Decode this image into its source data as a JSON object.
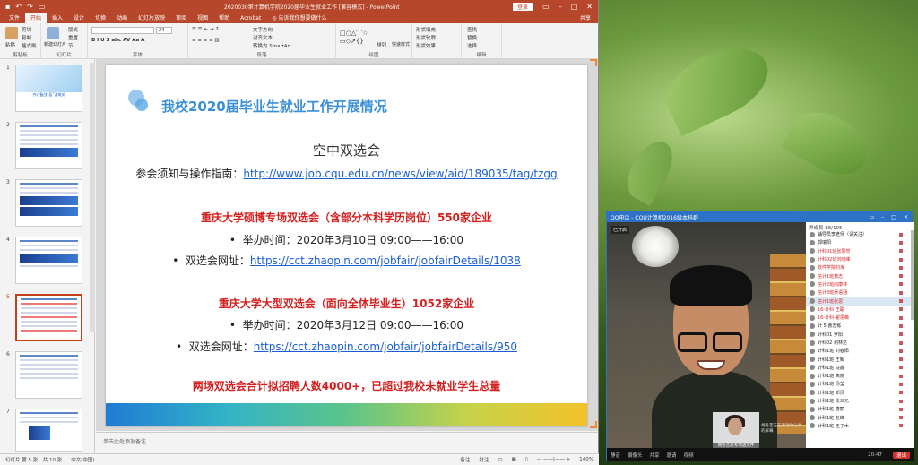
{
  "ppt": {
    "title": "2020030第计算机学院2020届毕业生就业工作 [兼容模式] - PowerPoint",
    "login": "登录",
    "tabs": [
      "文件",
      "开始",
      "插入",
      "设计",
      "切换",
      "动画",
      "幻灯片放映",
      "审阅",
      "视图",
      "帮助",
      "Acrobat"
    ],
    "active_tab": "开始",
    "tell_me": "告诉我你想要做什么",
    "share": "共享",
    "ribbon": {
      "paste": "粘贴",
      "cut": "剪切",
      "copy": "复制",
      "format_painter": "格式刷",
      "new_slide": "新建幻灯片",
      "layout": "版式",
      "reset": "重置",
      "section": "节",
      "font_size": "24",
      "text_direction": "文字方向",
      "align_text": "对齐文本",
      "convert_smartart": "转换为 SmartArt",
      "arrange": "排列",
      "quick_styles": "快速样式",
      "shape_fill": "形状填充",
      "shape_outline": "形状轮廓",
      "shape_effects": "形状效果",
      "find": "查找",
      "replace": "替换",
      "select": "选择",
      "groups": [
        "剪贴板",
        "幻灯片",
        "字体",
        "段落",
        "绘图",
        "编辑"
      ]
    },
    "slide": {
      "heading": "我校2020届毕业生就业工作开展情况",
      "subtitle": "空中双选会",
      "guide_label": "参会须知与操作指南：",
      "guide_link": "http://www.job.cqu.edu.cn/news/view/aid/189035/tag/tzgg",
      "fair1_title": "重庆大学硕博专场双选会（含部分本科学历岗位）550家企业",
      "fair1_time": "举办时间：2020年3月10日 09:00——16:00",
      "fair1_url_label": "双选会网址：",
      "fair1_url": "https://cct.zhaopin.com/jobfair/jobfairDetails/1038",
      "fair2_title": "重庆大学大型双选会（面向全体毕业生）1052家企业",
      "fair2_time": "举办时间：2020年3月12日 09:00——16:00",
      "fair2_url_label": "双选会网址：",
      "fair2_url": "https://cct.zhaopin.com/jobfair/jobfairDetails/950",
      "summary": "两场双选会合计拟招聘人数4000+，已超过我校未就业学生总量"
    },
    "thumbnail_numbers": [
      "1",
      "2",
      "3",
      "4",
      "5",
      "6",
      "7"
    ],
    "thumb1_text": "齐心备战“疫”渡难关",
    "notes_placeholder": "单击此处添加备注",
    "status": {
      "slide_count": "幻灯片 第 5 张，共 10 张",
      "language": "中文(中国)",
      "notes_btn": "备注",
      "comments_btn": "批注",
      "zoom": "140%"
    }
  },
  "qq": {
    "title": "QQ电话 - CQU计算机2016级本科群",
    "members_header": "群成员 88/105",
    "video_tag": "已开启",
    "pip_label": "胡冬苦思考地送文件",
    "side_text": "胡冬苦正在邀请你分享的屏幕",
    "controls": [
      "静音",
      "摄像头",
      "共享",
      "邀请",
      "视频"
    ],
    "time": "20:47",
    "end_call": "退出",
    "members": [
      {
        "name": "辅导员李老师（请关注）",
        "red": false
      },
      {
        "name": "郭瑞阳",
        "red": false
      },
      {
        "name": "计科01班张思然",
        "red": true
      },
      {
        "name": "计科02班刘晓峰",
        "red": true
      },
      {
        "name": "软件学院刘海",
        "red": true
      },
      {
        "name": "信计1班黄志",
        "red": true
      },
      {
        "name": "信计2班向康林",
        "red": true
      },
      {
        "name": "信计3班吴语涵",
        "red": true
      },
      {
        "name": "信计1班张思",
        "red": true
      },
      {
        "name": "16-计科 王聪",
        "red": true
      },
      {
        "name": "16-计科-翟思薇",
        "red": true
      },
      {
        "name": "计 5 曹志栋",
        "red": false
      },
      {
        "name": "计科01 罗阳",
        "red": false
      },
      {
        "name": "计科02 谢林达",
        "red": false
      },
      {
        "name": "计科1班 刘春阳",
        "red": false
      },
      {
        "name": "计科1班 王新",
        "red": false
      },
      {
        "name": "计科1班 马鑫",
        "red": false
      },
      {
        "name": "计科1班 高晓",
        "red": false
      },
      {
        "name": "计科1班 杨莹",
        "red": false
      },
      {
        "name": "计科1班 邓贝",
        "red": false
      },
      {
        "name": "计科1班 张三元",
        "red": false
      },
      {
        "name": "计科1班 唐丽",
        "red": false
      },
      {
        "name": "计科1班 赵峰",
        "red": false
      },
      {
        "name": "计科1班 王子木",
        "red": false
      }
    ]
  },
  "colors": {
    "ppt_red": "#b7472a",
    "heading_blue": "#3a8fd6",
    "emph_red": "#d41f1f",
    "link_blue": "#1a5fd0",
    "qq_blue": "#2e72c8"
  }
}
